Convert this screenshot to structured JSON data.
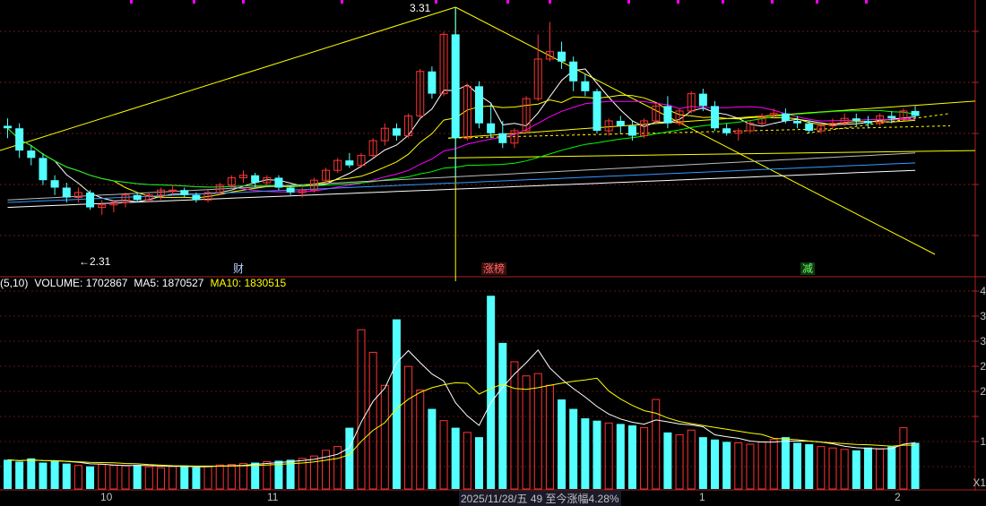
{
  "price": {
    "high_label": "3.31",
    "low_label": "←2.31",
    "markers": [
      {
        "text": "财",
        "color": "#b8cfff"
      },
      {
        "text": "涨榜",
        "color": "#ff6666"
      },
      {
        "text": "减",
        "color": "#66ff66"
      }
    ]
  },
  "volume": {
    "header": {
      "prefix": "(5,10)",
      "volume_label": "VOLUME: 1702867",
      "ma5_label": "MA5: 1870527",
      "ma10_label": "MA10: 1830515"
    },
    "y_ticks": [
      "4",
      "3",
      "3",
      "2",
      "2",
      "1"
    ]
  },
  "x_axis": {
    "labels": [
      "10",
      "11",
      "1",
      "2"
    ]
  },
  "status_bar": "2025/11/28/五 49 至今涨幅4.28%",
  "corner_label": "X1",
  "colors": {
    "up": "#ff3333",
    "down": "#54ffff",
    "ma5": "#ffffff",
    "ma10": "#ffff00",
    "ma20": "#ff00ff",
    "ma60": "#00ff00",
    "ma120": "#8888ff",
    "grid": "#aa2222",
    "trend": "#ffff00"
  },
  "chart_data": {
    "type": "candlestick",
    "price_range": [
      2.31,
      3.31
    ],
    "candles": [
      [
        2.83,
        2.86,
        2.78,
        2.82
      ],
      [
        2.82,
        2.84,
        2.7,
        2.73
      ],
      [
        2.73,
        2.75,
        2.67,
        2.7
      ],
      [
        2.7,
        2.72,
        2.59,
        2.61
      ],
      [
        2.61,
        2.63,
        2.55,
        2.58
      ],
      [
        2.58,
        2.6,
        2.52,
        2.54
      ],
      [
        2.54,
        2.58,
        2.52,
        2.56
      ],
      [
        2.56,
        2.57,
        2.49,
        2.5
      ],
      [
        2.5,
        2.53,
        2.47,
        2.51
      ],
      [
        2.51,
        2.53,
        2.48,
        2.52
      ],
      [
        2.52,
        2.56,
        2.5,
        2.55
      ],
      [
        2.55,
        2.56,
        2.52,
        2.53
      ],
      [
        2.53,
        2.56,
        2.52,
        2.55
      ],
      [
        2.55,
        2.58,
        2.53,
        2.57
      ],
      [
        2.57,
        2.59,
        2.55,
        2.57
      ],
      [
        2.57,
        2.58,
        2.54,
        2.55
      ],
      [
        2.55,
        2.56,
        2.52,
        2.53
      ],
      [
        2.53,
        2.57,
        2.52,
        2.56
      ],
      [
        2.56,
        2.6,
        2.55,
        2.59
      ],
      [
        2.59,
        2.63,
        2.58,
        2.62
      ],
      [
        2.62,
        2.65,
        2.6,
        2.63
      ],
      [
        2.63,
        2.64,
        2.58,
        2.6
      ],
      [
        2.6,
        2.63,
        2.59,
        2.62
      ],
      [
        2.62,
        2.63,
        2.57,
        2.58
      ],
      [
        2.58,
        2.59,
        2.55,
        2.56
      ],
      [
        2.56,
        2.58,
        2.54,
        2.57
      ],
      [
        2.57,
        2.62,
        2.56,
        2.61
      ],
      [
        2.61,
        2.66,
        2.6,
        2.65
      ],
      [
        2.65,
        2.7,
        2.64,
        2.69
      ],
      [
        2.69,
        2.72,
        2.66,
        2.67
      ],
      [
        2.67,
        2.72,
        2.66,
        2.71
      ],
      [
        2.71,
        2.78,
        2.7,
        2.77
      ],
      [
        2.77,
        2.84,
        2.75,
        2.82
      ],
      [
        2.82,
        2.84,
        2.77,
        2.79
      ],
      [
        2.79,
        2.88,
        2.78,
        2.87
      ],
      [
        2.87,
        3.06,
        2.86,
        3.05
      ],
      [
        3.05,
        3.07,
        2.94,
        2.96
      ],
      [
        2.96,
        3.21,
        2.95,
        3.2
      ],
      [
        3.2,
        3.31,
        2.62,
        2.78
      ],
      [
        2.78,
        3.0,
        2.77,
        2.99
      ],
      [
        2.99,
        3.01,
        2.82,
        2.84
      ],
      [
        2.84,
        2.92,
        2.78,
        2.8
      ],
      [
        2.8,
        2.85,
        2.74,
        2.76
      ],
      [
        2.76,
        2.82,
        2.74,
        2.81
      ],
      [
        2.81,
        2.95,
        2.8,
        2.94
      ],
      [
        2.94,
        3.2,
        2.93,
        3.1
      ],
      [
        3.1,
        3.25,
        3.09,
        3.13
      ],
      [
        3.13,
        3.17,
        3.06,
        3.09
      ],
      [
        3.09,
        3.11,
        2.97,
        3.01
      ],
      [
        3.01,
        3.04,
        2.95,
        2.97
      ],
      [
        2.97,
        2.98,
        2.8,
        2.81
      ],
      [
        2.81,
        2.86,
        2.79,
        2.85
      ],
      [
        2.85,
        2.87,
        2.8,
        2.83
      ],
      [
        2.83,
        2.85,
        2.77,
        2.79
      ],
      [
        2.79,
        2.86,
        2.78,
        2.85
      ],
      [
        2.85,
        2.92,
        2.84,
        2.91
      ],
      [
        2.91,
        2.95,
        2.82,
        2.84
      ],
      [
        2.84,
        2.9,
        2.83,
        2.89
      ],
      [
        2.89,
        2.97,
        2.88,
        2.96
      ],
      [
        2.96,
        2.98,
        2.89,
        2.91
      ],
      [
        2.91,
        2.93,
        2.81,
        2.82
      ],
      [
        2.82,
        2.84,
        2.79,
        2.8
      ],
      [
        2.8,
        2.82,
        2.77,
        2.81
      ],
      [
        2.81,
        2.85,
        2.8,
        2.84
      ],
      [
        2.84,
        2.88,
        2.83,
        2.87
      ],
      [
        2.87,
        2.9,
        2.86,
        2.88
      ],
      [
        2.88,
        2.9,
        2.84,
        2.85
      ],
      [
        2.85,
        2.87,
        2.82,
        2.84
      ],
      [
        2.84,
        2.85,
        2.8,
        2.81
      ],
      [
        2.81,
        2.84,
        2.8,
        2.83
      ],
      [
        2.83,
        2.86,
        2.82,
        2.84
      ],
      [
        2.84,
        2.88,
        2.83,
        2.86
      ],
      [
        2.86,
        2.88,
        2.83,
        2.85
      ],
      [
        2.85,
        2.87,
        2.82,
        2.84
      ],
      [
        2.84,
        2.88,
        2.83,
        2.87
      ],
      [
        2.87,
        2.89,
        2.84,
        2.86
      ],
      [
        2.86,
        2.9,
        2.85,
        2.89
      ],
      [
        2.89,
        2.91,
        2.86,
        2.87
      ]
    ],
    "volume": [
      620,
      580,
      650,
      560,
      590,
      540,
      500,
      480,
      520,
      500,
      490,
      510,
      470,
      450,
      480,
      500,
      460,
      480,
      510,
      520,
      540,
      560,
      580,
      600,
      620,
      650,
      700,
      820,
      900,
      1300,
      3380,
      2900,
      2200,
      3600,
      2600,
      2100,
      1700,
      1450,
      1300,
      1200,
      1100,
      4100,
      3100,
      2700,
      2400,
      2450,
      2200,
      1900,
      1700,
      1500,
      1450,
      1400,
      1380,
      1350,
      1300,
      1900,
      1200,
      1150,
      1250,
      1100,
      1050,
      1000,
      980,
      950,
      1000,
      1050,
      1100,
      980,
      950,
      900,
      870,
      840,
      820,
      880,
      850,
      900,
      1300,
      980
    ],
    "volume_range": [
      0,
      4200
    ],
    "moving_averages": [
      "MA5",
      "MA10"
    ]
  }
}
